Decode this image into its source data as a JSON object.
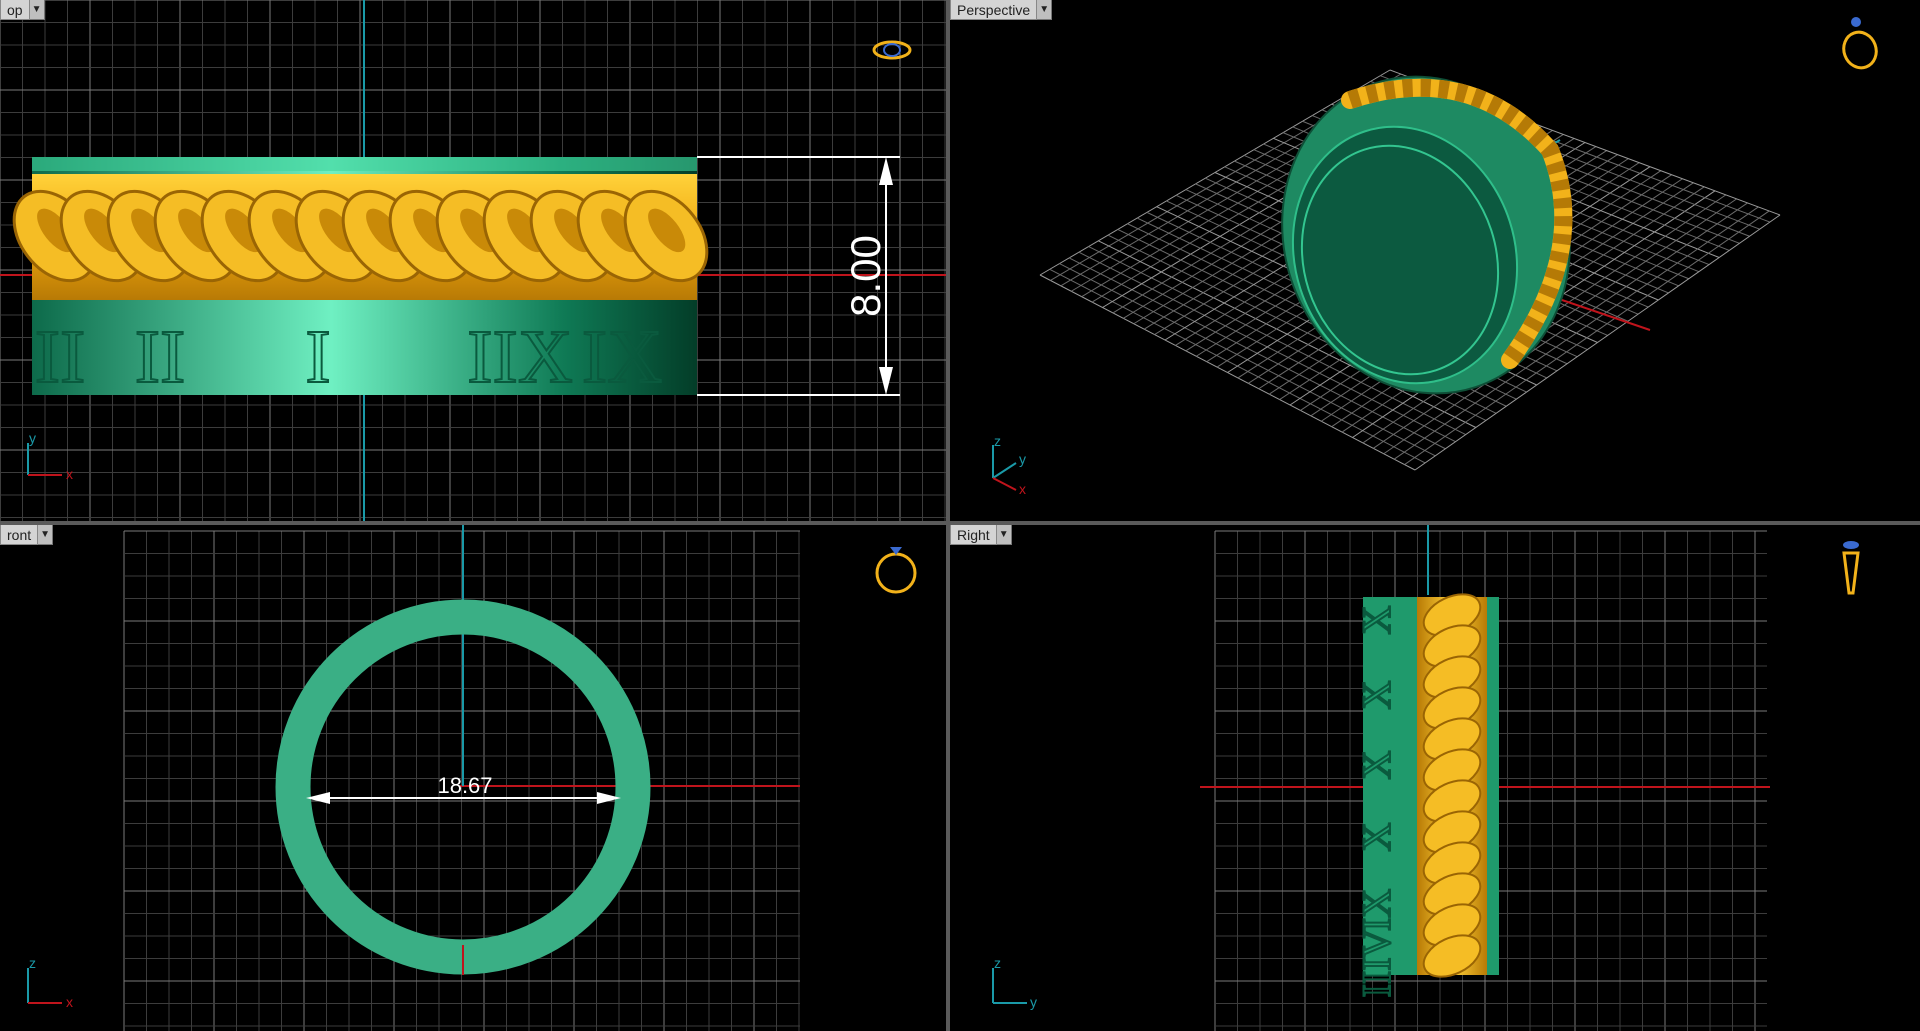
{
  "viewports": {
    "top": {
      "label": "op",
      "dimension": "8.00",
      "numerals": [
        "II",
        "II",
        "I",
        "IIX",
        "IX"
      ]
    },
    "perspective": {
      "label": "Perspective"
    },
    "front": {
      "label": "ront",
      "dimension": "18.67"
    },
    "right": {
      "label": "Right",
      "numerals": [
        "X",
        "X",
        "X",
        "X",
        "IX",
        "IIIV"
      ]
    }
  },
  "axes": {
    "top": {
      "vertical": "y",
      "horizontal": "x"
    },
    "perspective": {
      "z": "z",
      "y": "y",
      "x": "x"
    },
    "front": {
      "vertical": "z",
      "horizontal": "x"
    },
    "right": {
      "vertical": "z",
      "horizontal": "y"
    }
  },
  "icons": {
    "dropdown": "chevron-down-icon",
    "view_cube": "ring-view-icon"
  },
  "colors": {
    "ring_green": "#2fa67c",
    "chain_gold": "#f2b21a",
    "grid": "#5c5c5c",
    "axis_red": "#c0141c",
    "axis_cyan": "#1a9aa8",
    "dimension": "#ffffff"
  }
}
